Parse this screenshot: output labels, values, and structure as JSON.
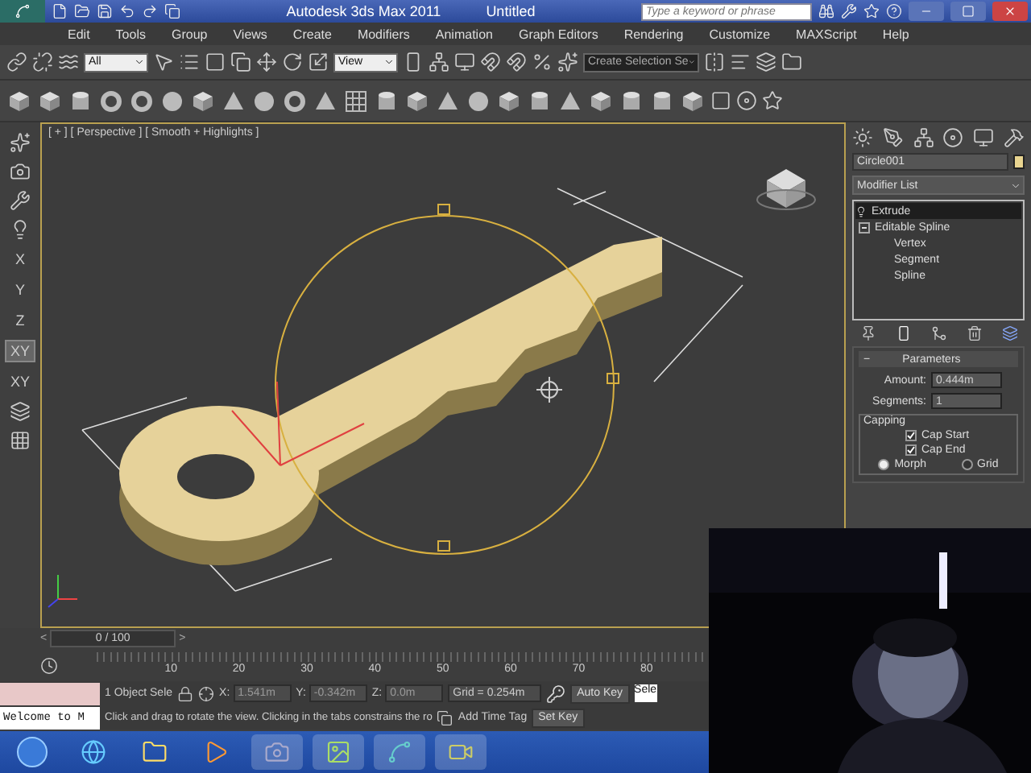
{
  "title_bar": {
    "app": "Autodesk 3ds Max  2011",
    "document": "Untitled",
    "search_placeholder": "Type a keyword or phrase"
  },
  "menu": [
    "Edit",
    "Tools",
    "Group",
    "Views",
    "Create",
    "Modifiers",
    "Animation",
    "Graph Editors",
    "Rendering",
    "Customize",
    "MAXScript",
    "Help"
  ],
  "main_toolbar": {
    "selection_filter": "All",
    "reference_coordinate": "View",
    "named_selection": "Create Selection Se"
  },
  "axis_constraints": [
    {
      "label": "X",
      "selected": false
    },
    {
      "label": "Y",
      "selected": false
    },
    {
      "label": "Z",
      "selected": false
    },
    {
      "label": "XY",
      "selected": true
    },
    {
      "label": "XY",
      "selected": false
    }
  ],
  "viewport": {
    "label": "[ + ] [ Perspective ] [ Smooth + Highlights ]"
  },
  "command_panel": {
    "object_name": "Circle001",
    "modifier_list": "Modifier List",
    "stack": [
      {
        "label": "Extrude",
        "selected": true
      },
      {
        "label": "Editable Spline",
        "selected": false,
        "expanded": true,
        "children": [
          {
            "label": "Vertex",
            "selected": false
          },
          {
            "label": "Segment",
            "selected": false
          },
          {
            "label": "Spline",
            "selected": false
          }
        ]
      }
    ],
    "rollout": {
      "toggle": "−",
      "title": "Parameters"
    },
    "parameters": [
      {
        "label": "Amount:",
        "value": "0.444m"
      },
      {
        "label": "Segments:",
        "value": "1"
      }
    ],
    "capping": {
      "title": "Capping",
      "options": [
        {
          "label": "Cap Start",
          "checked": true
        },
        {
          "label": "Cap End",
          "checked": true
        }
      ],
      "mode": [
        {
          "label": "Morph",
          "selected": true
        },
        {
          "label": "Grid",
          "selected": false
        }
      ]
    }
  },
  "time_slider": {
    "prev": "<",
    "label": "0 / 100",
    "next": ">"
  },
  "timeline": {
    "ticks": [
      "10",
      "20",
      "30",
      "40",
      "50",
      "60",
      "70",
      "80"
    ]
  },
  "status": {
    "listener_output": "Welcome to M",
    "selection": "1 Object Sele",
    "coords": [
      {
        "label": "X:",
        "value": "1.541m"
      },
      {
        "label": "Y:",
        "value": "-0.342m"
      },
      {
        "label": "Z:",
        "value": "0.0m"
      }
    ],
    "grid": "Grid = 0.254m",
    "auto_key": "Auto Key",
    "key_filter": "Sele",
    "prompt": "Click and drag to rotate the view.  Clicking in the tabs constrains the ro",
    "time_tag": "Add Time Tag",
    "set_key": "Set Key"
  }
}
